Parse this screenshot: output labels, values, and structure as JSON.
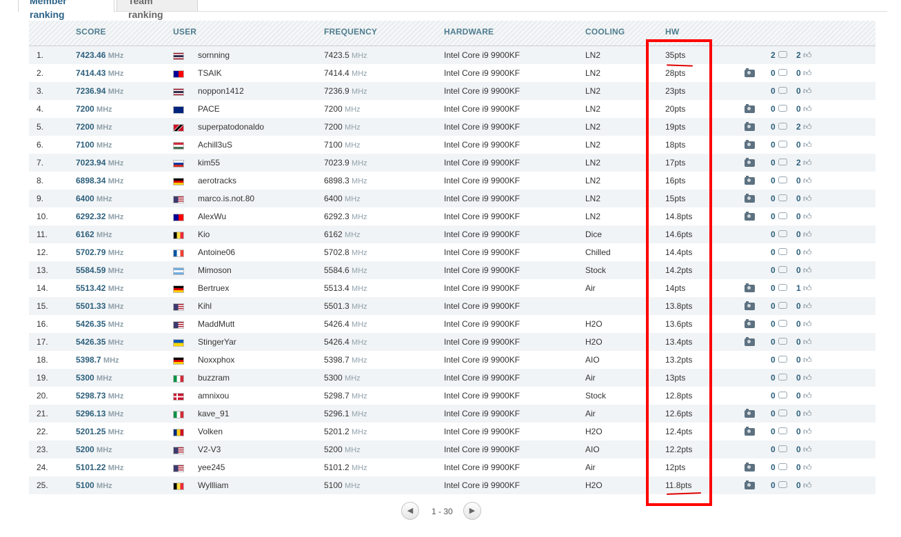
{
  "tabs": {
    "active": "Member ranking",
    "inactive": "Team ranking"
  },
  "headers": {
    "score": "SCORE",
    "user": "USER",
    "frequency": "FREQUENCY",
    "hardware": "HARDWARE",
    "cooling": "COOLING",
    "hw": "HW"
  },
  "unit": "MHz",
  "rows": [
    {
      "rank": "1.",
      "score": "7423.46",
      "flag": "thailand",
      "user": "sornning",
      "freq": "7423.5",
      "hardware": "Intel Core i9 9900KF",
      "cooling": "LN2",
      "pts": "35pts",
      "camera": false,
      "comments": "2",
      "likes": "2"
    },
    {
      "rank": "2.",
      "score": "7414.43",
      "flag": "taiwan",
      "user": "TSAIK",
      "freq": "7414.4",
      "hardware": "Intel Core i9 9900KF",
      "cooling": "LN2",
      "pts": "28pts",
      "camera": true,
      "comments": "0",
      "likes": "0"
    },
    {
      "rank": "3.",
      "score": "7236.94",
      "flag": "thailand",
      "user": "noppon1412",
      "freq": "7236.9",
      "hardware": "Intel Core i9 9900KF",
      "cooling": "LN2",
      "pts": "23pts",
      "camera": false,
      "comments": "0",
      "likes": "0"
    },
    {
      "rank": "4.",
      "score": "7200",
      "flag": "uk",
      "user": "PACE",
      "freq": "7200",
      "hardware": "Intel Core i9 9900KF",
      "cooling": "LN2",
      "pts": "20pts",
      "camera": true,
      "comments": "0",
      "likes": "0"
    },
    {
      "rank": "5.",
      "score": "7200",
      "flag": "trinidad",
      "user": "superpatodonaldo",
      "freq": "7200",
      "hardware": "Intel Core i9 9900KF",
      "cooling": "LN2",
      "pts": "19pts",
      "camera": true,
      "comments": "0",
      "likes": "2"
    },
    {
      "rank": "6.",
      "score": "7100",
      "flag": "hungary",
      "user": "Achill3uS",
      "freq": "7100",
      "hardware": "Intel Core i9 9900KF",
      "cooling": "LN2",
      "pts": "18pts",
      "camera": true,
      "comments": "0",
      "likes": "0"
    },
    {
      "rank": "7.",
      "score": "7023.94",
      "flag": "russia",
      "user": "kim55",
      "freq": "7023.9",
      "hardware": "Intel Core i9 9900KF",
      "cooling": "LN2",
      "pts": "17pts",
      "camera": true,
      "comments": "0",
      "likes": "2"
    },
    {
      "rank": "8.",
      "score": "6898.34",
      "flag": "germany",
      "user": "aerotracks",
      "freq": "6898.3",
      "hardware": "Intel Core i9 9900KF",
      "cooling": "LN2",
      "pts": "16pts",
      "camera": true,
      "comments": "0",
      "likes": "0"
    },
    {
      "rank": "9.",
      "score": "6400",
      "flag": "usa",
      "user": "marco.is.not.80",
      "freq": "6400",
      "hardware": "Intel Core i9 9900KF",
      "cooling": "LN2",
      "pts": "15pts",
      "camera": true,
      "comments": "0",
      "likes": "0"
    },
    {
      "rank": "10.",
      "score": "6292.32",
      "flag": "taiwan",
      "user": "AlexWu",
      "freq": "6292.3",
      "hardware": "Intel Core i9 9900KF",
      "cooling": "LN2",
      "pts": "14.8pts",
      "camera": true,
      "comments": "0",
      "likes": "0"
    },
    {
      "rank": "11.",
      "score": "6162",
      "flag": "belgium",
      "user": "Kio",
      "freq": "6162",
      "hardware": "Intel Core i9 9900KF",
      "cooling": "Dice",
      "pts": "14.6pts",
      "camera": false,
      "comments": "0",
      "likes": "0"
    },
    {
      "rank": "12.",
      "score": "5702.79",
      "flag": "france",
      "user": "Antoine06",
      "freq": "5702.8",
      "hardware": "Intel Core i9 9900KF",
      "cooling": "Chilled",
      "pts": "14.4pts",
      "camera": false,
      "comments": "0",
      "likes": "0"
    },
    {
      "rank": "13.",
      "score": "5584.59",
      "flag": "argentina",
      "user": "Mimoson",
      "freq": "5584.6",
      "hardware": "Intel Core i9 9900KF",
      "cooling": "Stock",
      "pts": "14.2pts",
      "camera": false,
      "comments": "0",
      "likes": "0"
    },
    {
      "rank": "14.",
      "score": "5513.42",
      "flag": "germany",
      "user": "Bertruex",
      "freq": "5513.4",
      "hardware": "Intel Core i9 9900KF",
      "cooling": "Air",
      "pts": "14pts",
      "camera": true,
      "comments": "0",
      "likes": "1"
    },
    {
      "rank": "15.",
      "score": "5501.33",
      "flag": "usa",
      "user": "Kihl",
      "freq": "5501.3",
      "hardware": "Intel Core i9 9900KF",
      "cooling": "",
      "pts": "13.8pts",
      "camera": true,
      "comments": "0",
      "likes": "0"
    },
    {
      "rank": "16.",
      "score": "5426.35",
      "flag": "usa",
      "user": "MaddMutt",
      "freq": "5426.4",
      "hardware": "Intel Core i9 9900KF",
      "cooling": "H2O",
      "pts": "13.6pts",
      "camera": true,
      "comments": "0",
      "likes": "0"
    },
    {
      "rank": "17.",
      "score": "5426.35",
      "flag": "ukraine",
      "user": "StingerYar",
      "freq": "5426.4",
      "hardware": "Intel Core i9 9900KF",
      "cooling": "H2O",
      "pts": "13.4pts",
      "camera": true,
      "comments": "0",
      "likes": "0"
    },
    {
      "rank": "18.",
      "score": "5398.7",
      "flag": "germany",
      "user": "Noxxphox",
      "freq": "5398.7",
      "hardware": "Intel Core i9 9900KF",
      "cooling": "AIO",
      "pts": "13.2pts",
      "camera": false,
      "comments": "0",
      "likes": "0"
    },
    {
      "rank": "19.",
      "score": "5300",
      "flag": "italy",
      "user": "buzzram",
      "freq": "5300",
      "hardware": "Intel Core i9 9900KF",
      "cooling": "Air",
      "pts": "13pts",
      "camera": false,
      "comments": "0",
      "likes": "0"
    },
    {
      "rank": "20.",
      "score": "5298.73",
      "flag": "denmark",
      "user": "amnixou",
      "freq": "5298.7",
      "hardware": "Intel Core i9 9900KF",
      "cooling": "Stock",
      "pts": "12.8pts",
      "camera": false,
      "comments": "0",
      "likes": "0"
    },
    {
      "rank": "21.",
      "score": "5296.13",
      "flag": "italy",
      "user": "kave_91",
      "freq": "5296.1",
      "hardware": "Intel Core i9 9900KF",
      "cooling": "Air",
      "pts": "12.6pts",
      "camera": true,
      "comments": "0",
      "likes": "0"
    },
    {
      "rank": "22.",
      "score": "5201.25",
      "flag": "romania",
      "user": "Volken",
      "freq": "5201.2",
      "hardware": "Intel Core i9 9900KF",
      "cooling": "H2O",
      "pts": "12.4pts",
      "camera": true,
      "comments": "0",
      "likes": "0"
    },
    {
      "rank": "23.",
      "score": "5200",
      "flag": "usa",
      "user": "V2-V3",
      "freq": "5200",
      "hardware": "Intel Core i9 9900KF",
      "cooling": "AIO",
      "pts": "12.2pts",
      "camera": false,
      "comments": "0",
      "likes": "0"
    },
    {
      "rank": "24.",
      "score": "5101.22",
      "flag": "usa",
      "user": "yee245",
      "freq": "5101.2",
      "hardware": "Intel Core i9 9900KF",
      "cooling": "Air",
      "pts": "12pts",
      "camera": true,
      "comments": "0",
      "likes": "0"
    },
    {
      "rank": "25.",
      "score": "5100",
      "flag": "belgium",
      "user": "Wyllliam",
      "freq": "5100",
      "hardware": "Intel Core i9 9900KF",
      "cooling": "H2O",
      "pts": "11.8pts",
      "camera": true,
      "comments": "0",
      "likes": "0"
    }
  ],
  "flag_styles": {
    "thailand": "linear-gradient(#a51931 0 17%, #fff 17% 33%, #2d2a4a 33% 67%, #fff 67% 83%, #a51931 83%)",
    "taiwan": "linear-gradient(90deg, #000095 0 50%, transparent 50%), #fe0000",
    "uk": "linear-gradient(#00247d, #00247d)",
    "trinidad": "linear-gradient(135deg, #ce1126 0 35%, #fff 35% 40%, #000 40% 60%, #fff 60% 65%, #ce1126 65%)",
    "hungary": "linear-gradient(#ce2939 0 33%, #fff 33% 67%, #477050 67%)",
    "russia": "linear-gradient(#fff 0 33%, #0039a6 33% 67%, #d52b1e 67%)",
    "germany": "linear-gradient(#000 0 33%, #dd0000 33% 67%, #ffce00 67%)",
    "usa": "linear-gradient(90deg, #3c3b6e 0 45%, transparent 45%), repeating-linear-gradient(#b22234 0 1.5px, #fff 1.5px 3px)",
    "belgium": "linear-gradient(90deg, #000 0 33%, #fae042 33% 67%, #ed2939 67%)",
    "france": "linear-gradient(90deg, #0055a4 0 33%, #fff 33% 67%, #ef4135 67%)",
    "argentina": "linear-gradient(#74acdf 0 33%, #fff 33% 67%, #74acdf 67%)",
    "ukraine": "linear-gradient(#0057b7 0 50%, #ffd700 50%)",
    "italy": "linear-gradient(90deg, #009246 0 33%, #fff 33% 67%, #ce2b37 67%)",
    "denmark": "linear-gradient(90deg, transparent 0 30%, #fff 30% 42%, transparent 42%), linear-gradient(transparent 0 40%, #fff 40% 60%, transparent 60%), #c8102e",
    "romania": "linear-gradient(90deg, #002b7f 0 33%, #fcd116 33% 67%, #ce1126 67%)"
  },
  "pager": {
    "range": "1 - 30",
    "prev_icon": "chevron-left-icon",
    "next_icon": "chevron-right-icon"
  }
}
